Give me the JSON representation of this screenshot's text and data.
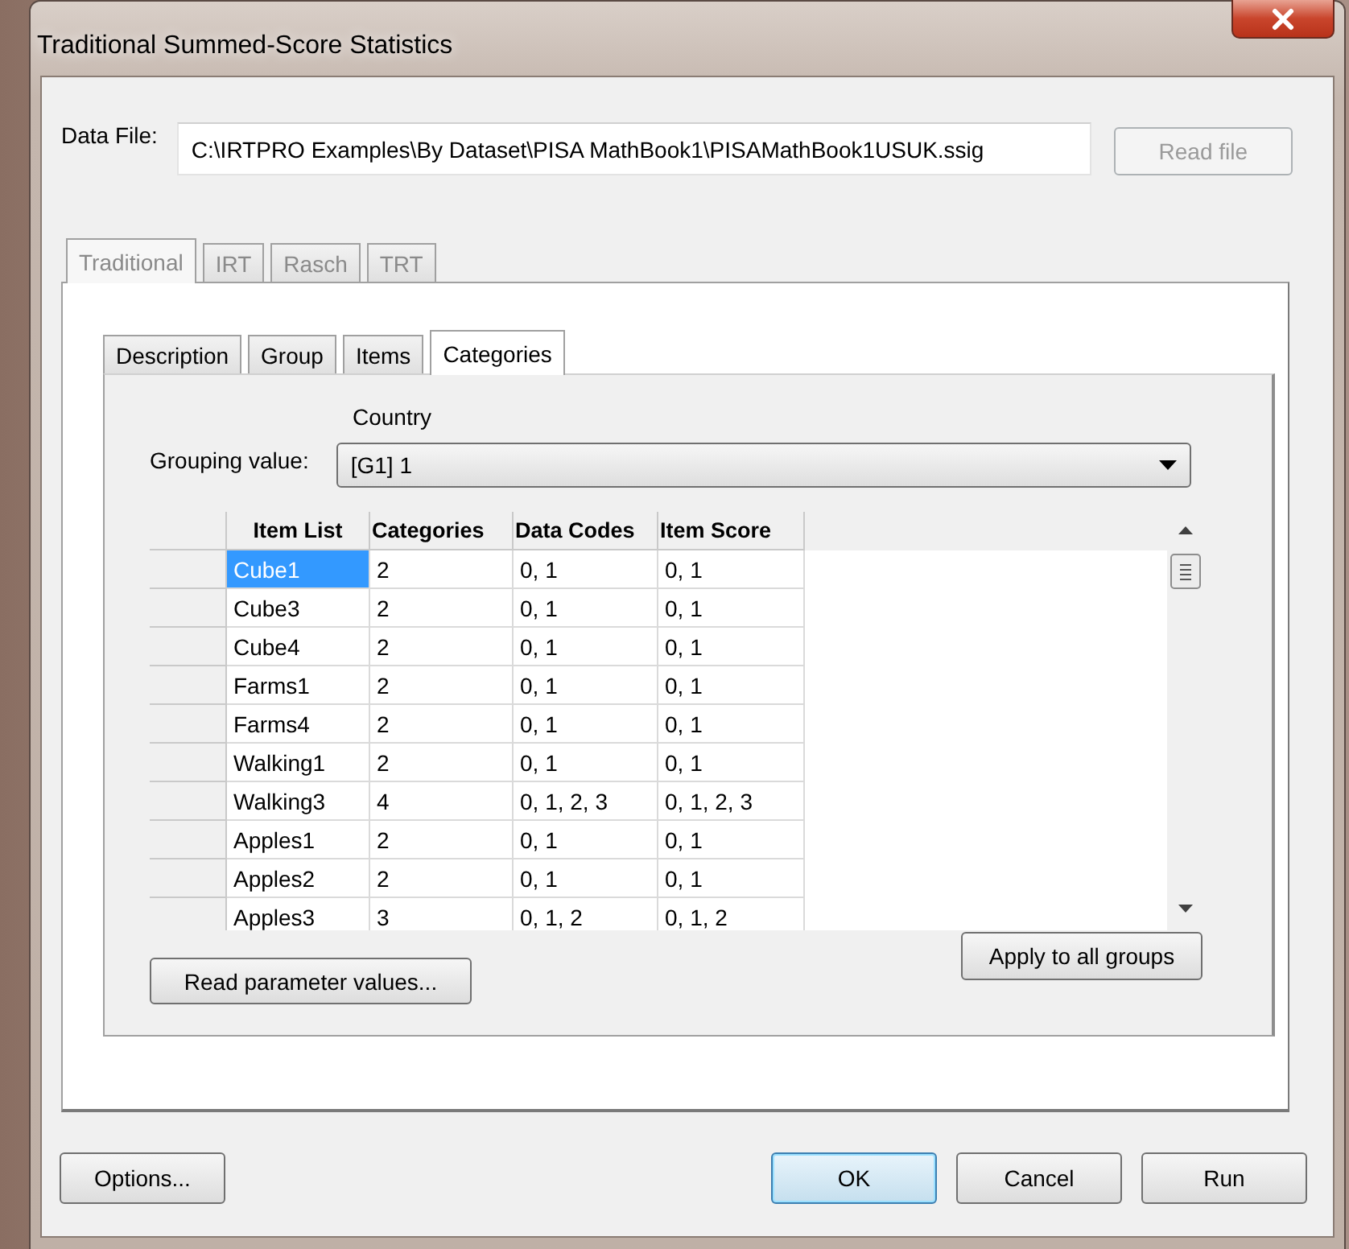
{
  "window": {
    "title": "Traditional Summed-Score Statistics"
  },
  "data_file": {
    "label": "Data File:",
    "value": "C:\\IRTPRO Examples\\By Dataset\\PISA MathBook1\\PISAMathBook1USUK.ssig",
    "read_button": {
      "label": "Read file",
      "disabled": true
    }
  },
  "outer_tabs": [
    {
      "label": "Traditional",
      "selected": true,
      "disabled": true
    },
    {
      "label": "IRT",
      "selected": false,
      "disabled": true
    },
    {
      "label": "Rasch",
      "selected": false,
      "disabled": true
    },
    {
      "label": "TRT",
      "selected": false,
      "disabled": true
    }
  ],
  "inner_tabs": [
    {
      "label": "Description",
      "selected": false
    },
    {
      "label": "Group",
      "selected": false
    },
    {
      "label": "Items",
      "selected": false
    },
    {
      "label": "Categories",
      "selected": true
    }
  ],
  "grouping": {
    "caption": "Country",
    "label": "Grouping value:",
    "value": "[G1] 1"
  },
  "grid": {
    "columns": [
      "Item List",
      "Categories",
      "Data Codes",
      "Item Score"
    ],
    "rows": [
      {
        "cells": [
          "Cube1",
          "2",
          "0, 1",
          "0, 1"
        ],
        "selected": true
      },
      {
        "cells": [
          "Cube3",
          "2",
          "0, 1",
          "0, 1"
        ],
        "selected": false
      },
      {
        "cells": [
          "Cube4",
          "2",
          "0, 1",
          "0, 1"
        ],
        "selected": false
      },
      {
        "cells": [
          "Farms1",
          "2",
          "0, 1",
          "0, 1"
        ],
        "selected": false
      },
      {
        "cells": [
          "Farms4",
          "2",
          "0, 1",
          "0, 1"
        ],
        "selected": false
      },
      {
        "cells": [
          "Walking1",
          "2",
          "0, 1",
          "0, 1"
        ],
        "selected": false
      },
      {
        "cells": [
          "Walking3",
          "4",
          "0, 1, 2, 3",
          "0, 1, 2, 3"
        ],
        "selected": false
      },
      {
        "cells": [
          "Apples1",
          "2",
          "0, 1",
          "0, 1"
        ],
        "selected": false
      },
      {
        "cells": [
          "Apples2",
          "2",
          "0, 1",
          "0, 1"
        ],
        "selected": false
      },
      {
        "cells": [
          "Apples3",
          "3",
          "0, 1, 2",
          "0, 1, 2"
        ],
        "selected": false
      }
    ]
  },
  "read_parameters_button": "Read parameter values...",
  "apply_button": "Apply to all groups",
  "footer": {
    "buttons": [
      {
        "label": "Options...",
        "kind": "left"
      },
      {
        "label": "OK",
        "kind": "default"
      },
      {
        "label": "Cancel",
        "kind": "normal"
      },
      {
        "label": "Run",
        "kind": "normal"
      }
    ]
  }
}
